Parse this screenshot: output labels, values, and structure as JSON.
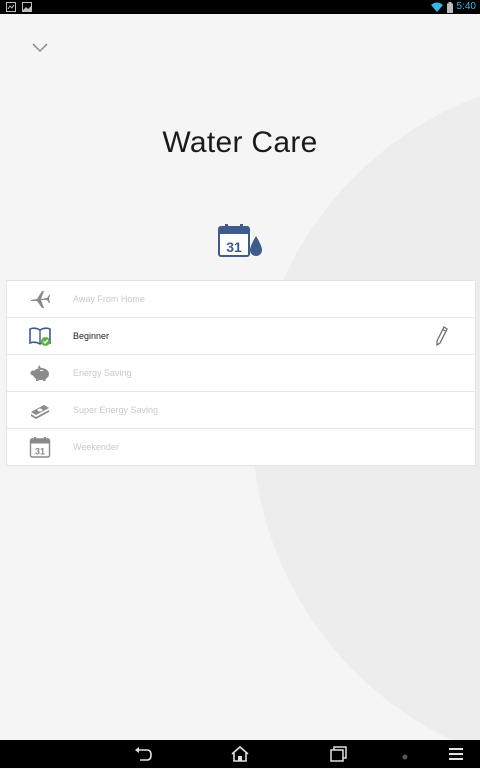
{
  "status_bar": {
    "time": "5:40",
    "icons": [
      "notification-image-icon",
      "gallery-icon",
      "wifi-icon",
      "battery-icon"
    ],
    "accent_color": "#39b5e6"
  },
  "page": {
    "title": "Water Care",
    "header_icon": "calendar-water-drop-icon",
    "calendar_day": "31"
  },
  "modes": [
    {
      "label": "Away From Home",
      "icon": "airplane-icon",
      "active": false
    },
    {
      "label": "Beginner",
      "icon": "book-check-icon",
      "active": true,
      "edit_icon": "pencil-icon"
    },
    {
      "label": "Energy Saving",
      "icon": "piggy-bank-icon",
      "active": false
    },
    {
      "label": "Super Energy Saving",
      "icon": "money-stack-icon",
      "active": false
    },
    {
      "label": "Weekender",
      "icon": "calendar-icon",
      "active": false,
      "calendar_day": "31"
    }
  ],
  "nav_bar": {
    "buttons": [
      "back-icon",
      "home-icon",
      "recent-apps-icon",
      "menu-icon"
    ]
  },
  "colors": {
    "icon_blue": "#3e5b8c",
    "icon_gray": "#8a8a8d",
    "check_green": "#5cb23a"
  }
}
